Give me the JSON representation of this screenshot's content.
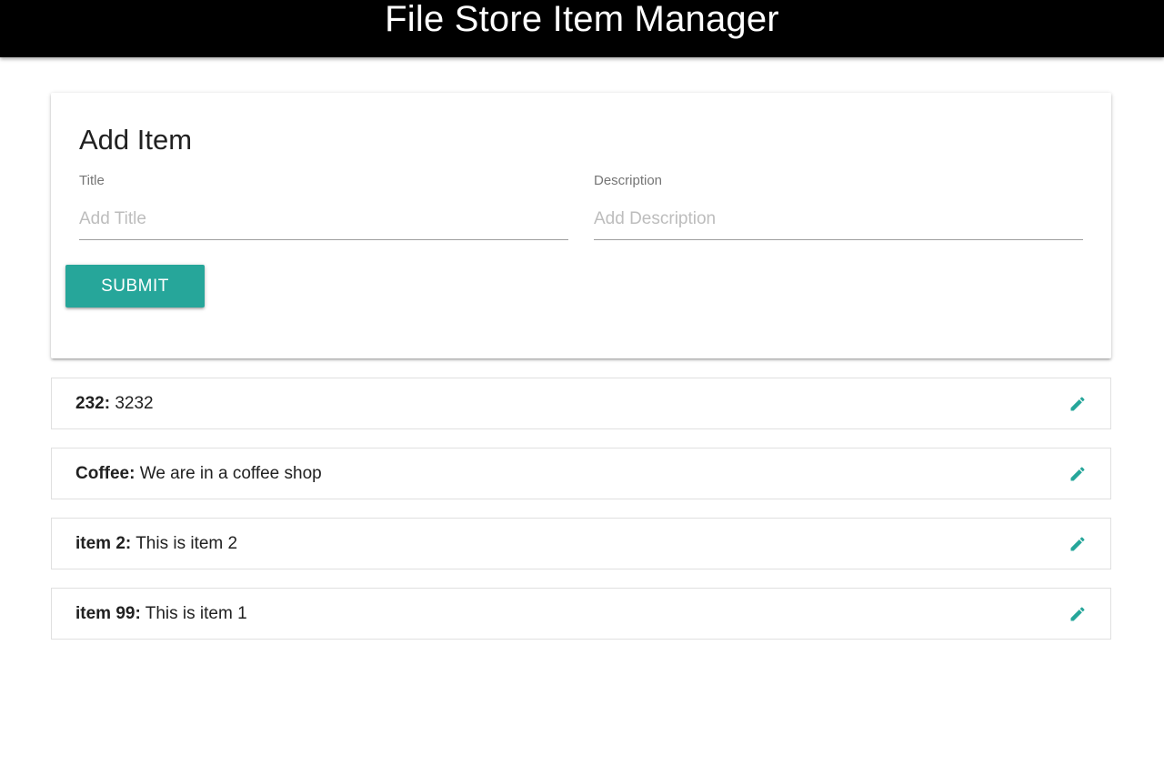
{
  "header": {
    "title": "File Store Item Manager"
  },
  "add_item": {
    "heading": "Add Item",
    "title_label": "Title",
    "title_value": "",
    "title_placeholder": "Add Title",
    "description_label": "Description",
    "description_value": "",
    "description_placeholder": "Add Description",
    "submit_label": "SUBMIT"
  },
  "items": [
    {
      "name": "232:",
      "description": "3232",
      "icon": "pencil-icon"
    },
    {
      "name": "Coffee:",
      "description": "We are in a coffee shop",
      "icon": "pencil-icon"
    },
    {
      "name": "item 2:",
      "description": "This is item 2",
      "icon": "pencil-icon"
    },
    {
      "name": "item 99:",
      "description": "This is item 1",
      "icon": "pencil-icon"
    }
  ],
  "colors": {
    "accent": "#26a69a",
    "header_bg": "#000000"
  }
}
